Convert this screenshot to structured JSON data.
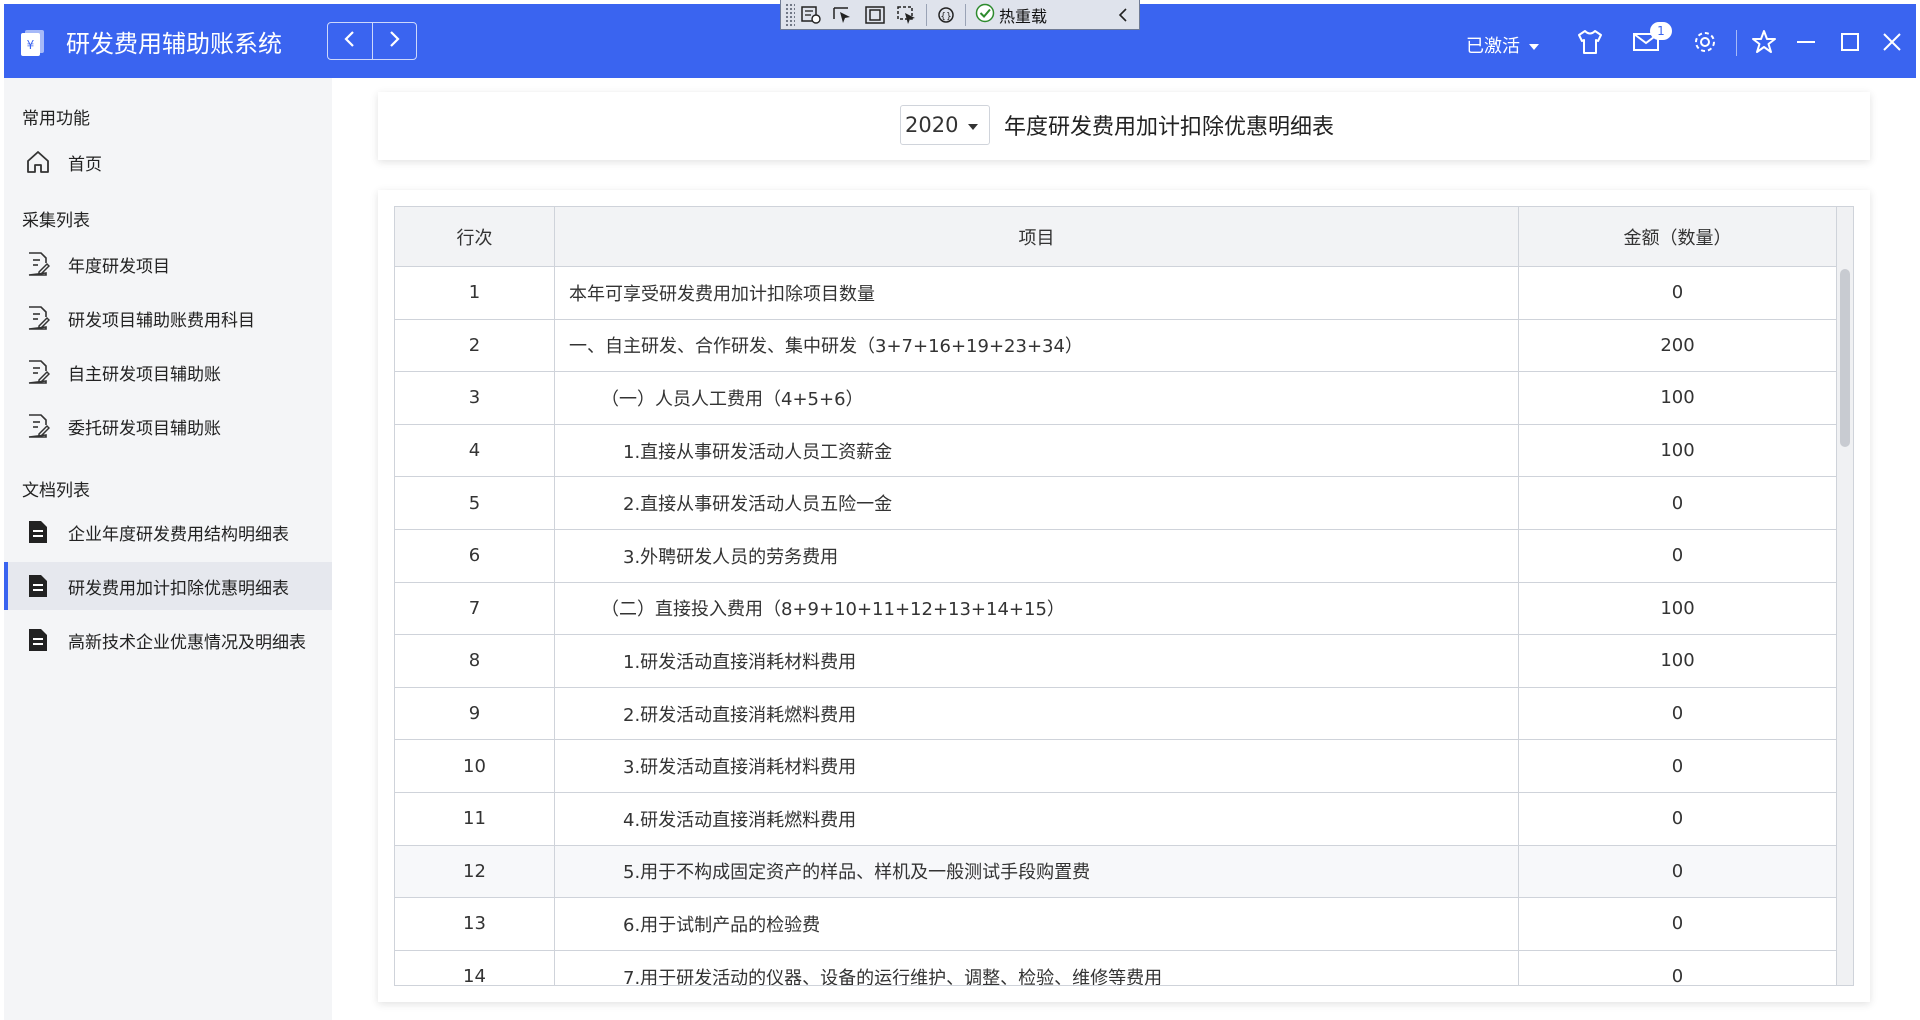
{
  "app": {
    "title": "研发费用辅助账系统"
  },
  "dev_toolbar": {
    "hot_reload_label": "热重载"
  },
  "titlebar": {
    "status_label": "已激活",
    "mail_count": "1"
  },
  "sidebar": {
    "sections": [
      {
        "title": "常用功能",
        "items": [
          {
            "label": "首页",
            "icon": "home-icon"
          }
        ]
      },
      {
        "title": "采集列表",
        "items": [
          {
            "label": "年度研发项目",
            "icon": "edit-document-icon"
          },
          {
            "label": "研发项目辅助账费用科目",
            "icon": "edit-document-icon"
          },
          {
            "label": "自主研发项目辅助账",
            "icon": "edit-document-icon"
          },
          {
            "label": "委托研发项目辅助账",
            "icon": "edit-document-icon"
          }
        ]
      },
      {
        "title": "文档列表",
        "items": [
          {
            "label": "企业年度研发费用结构明细表",
            "icon": "document-icon"
          },
          {
            "label": "研发费用加计扣除优惠明细表",
            "icon": "document-icon",
            "active": true
          },
          {
            "label": "高新技术企业优惠情况及明细表",
            "icon": "document-icon"
          }
        ]
      }
    ]
  },
  "main": {
    "year": "2020",
    "title": "年度研发费用加计扣除优惠明细表",
    "table": {
      "columns": [
        "行次",
        "项目",
        "金额（数量）"
      ],
      "rows": [
        {
          "no": "1",
          "item": "本年可享受研发费用加计扣除项目数量",
          "amount": "0"
        },
        {
          "no": "2",
          "item": "一、自主研发、合作研发、集中研发（3+7+16+19+23+34）",
          "amount": "200"
        },
        {
          "no": "3",
          "item": "（一）人员人工费用（4+5+6）",
          "amount": "100"
        },
        {
          "no": "4",
          "item": "1.直接从事研发活动人员工资薪金",
          "amount": "100"
        },
        {
          "no": "5",
          "item": "2.直接从事研发活动人员五险一金",
          "amount": "0"
        },
        {
          "no": "6",
          "item": "3.外聘研发人员的劳务费用",
          "amount": "0"
        },
        {
          "no": "7",
          "item": "（二）直接投入费用（8+9+10+11+12+13+14+15）",
          "amount": "100"
        },
        {
          "no": "8",
          "item": "1.研发活动直接消耗材料费用",
          "amount": "100"
        },
        {
          "no": "9",
          "item": "2.研发活动直接消耗燃料费用",
          "amount": "0"
        },
        {
          "no": "10",
          "item": "3.研发活动直接消耗材料费用",
          "amount": "0"
        },
        {
          "no": "11",
          "item": "4.研发活动直接消耗燃料费用",
          "amount": "0"
        },
        {
          "no": "12",
          "item": "5.用于不构成固定资产的样品、样机及一般测试手段购置费",
          "amount": "0"
        },
        {
          "no": "13",
          "item": "6.用于试制产品的检验费",
          "amount": "0"
        },
        {
          "no": "14",
          "item": "7.用于研发活动的仪器、设备的运行维护、调整、检验、维修等费用",
          "amount": "0"
        }
      ]
    }
  },
  "colors": {
    "brand": "#3a64f0",
    "sidebar_bg": "#f4f5f7"
  }
}
